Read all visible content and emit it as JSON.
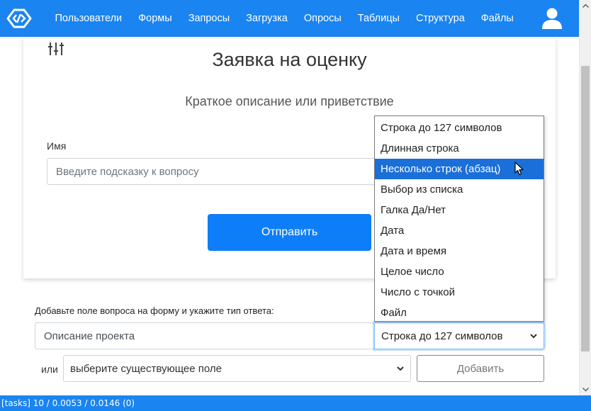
{
  "nav": {
    "items": [
      "Пользователи",
      "Формы",
      "Запросы",
      "Загрузка",
      "Опросы",
      "Таблицы",
      "Структура",
      "Файлы"
    ]
  },
  "form": {
    "title": "Заявка на оценку",
    "description": "Краткое описание или приветствие",
    "field_label": "Имя",
    "field_placeholder": "Введите подсказку к вопросу",
    "submit_label": "Отправить"
  },
  "add_field": {
    "label": "Добавьте поле вопроса на форму и укажите тип ответа:",
    "question_value": "Описание проекта",
    "type_value": "Строка до 127 символов",
    "or_label": "или",
    "existing_placeholder": "выберите существующее поле",
    "add_label": "Добавить"
  },
  "dropdown": {
    "options": [
      "Строка до 127 символов",
      "Длинная строка",
      "Несколько строк (абзац)",
      "Выбор из списка",
      "Галка Да/Нет",
      "Дата",
      "Дата и время",
      "Целое число",
      "Число с точкой",
      "Файл"
    ],
    "highlighted_index": 2
  },
  "status": {
    "text": "[tasks] 10 / 0.0053 / 0.0146 (0)"
  },
  "colors": {
    "navbar": "#1a84f0",
    "primary_button": "#0d7ef8",
    "highlight": "#1a6fd9"
  },
  "icons": {
    "logo": "logo-icon",
    "user": "user-icon",
    "settings": "sliders-icon"
  }
}
